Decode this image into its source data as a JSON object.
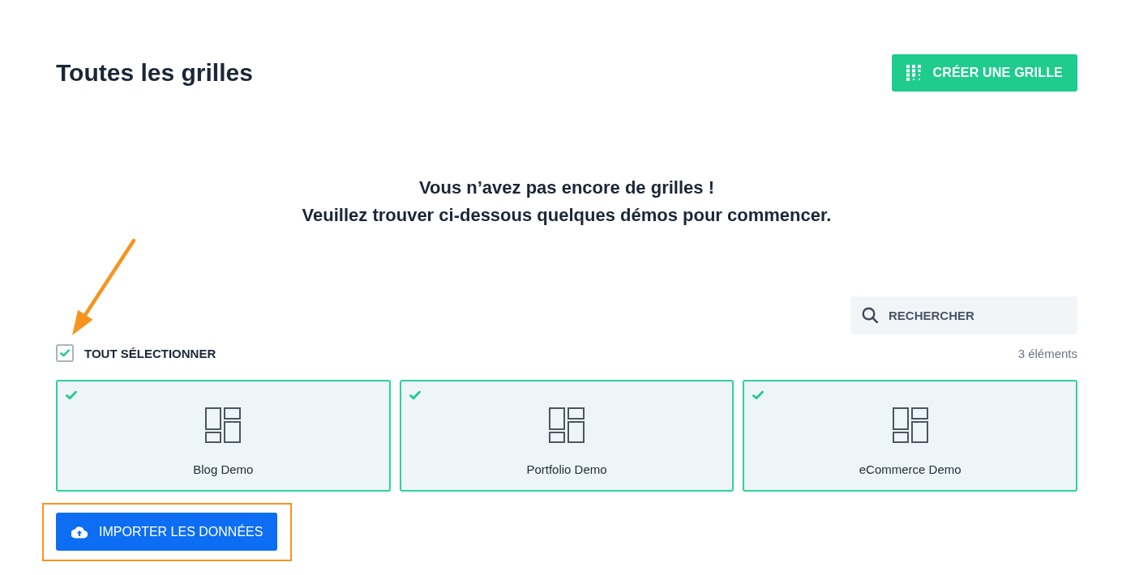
{
  "header": {
    "title": "Toutes les grilles",
    "create_button": "CRÉER UNE GRILLE"
  },
  "empty_state": {
    "lines": [
      "Vous n’avez pas encore de grilles !",
      "Veuillez trouver ci-dessous quelques démos pour commencer."
    ]
  },
  "search": {
    "placeholder": "RECHERCHER"
  },
  "select_all": {
    "label": "TOUT SÉLECTIONNER",
    "checked": true
  },
  "count": "3 éléments",
  "demos": [
    {
      "name": "Blog Demo",
      "selected": true
    },
    {
      "name": "Portfolio Demo",
      "selected": true
    },
    {
      "name": "eCommerce Demo",
      "selected": true
    }
  ],
  "import_button": "IMPORTER LES DONNÉES"
}
